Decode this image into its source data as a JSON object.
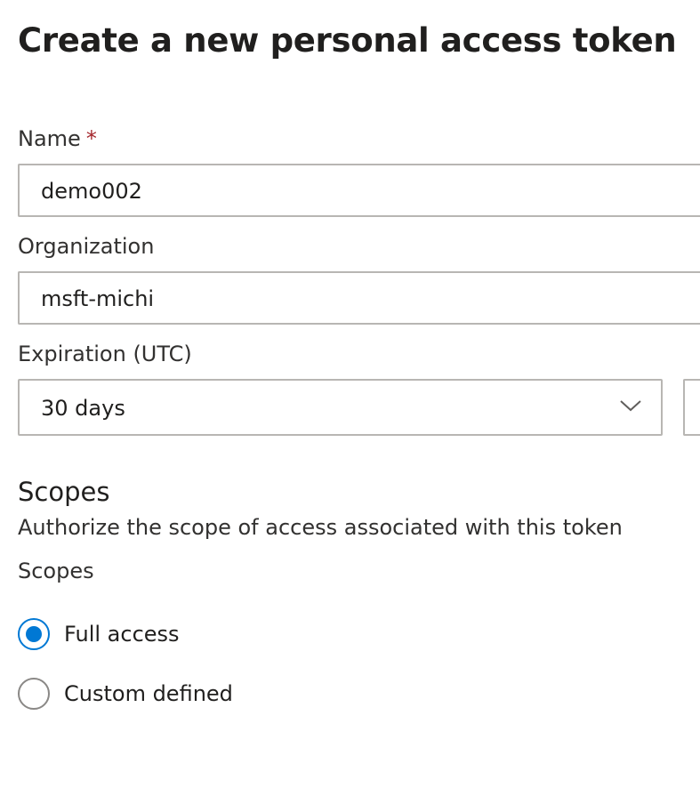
{
  "page": {
    "title": "Create a new personal access token"
  },
  "name_field": {
    "label": "Name",
    "required_marker": "*",
    "value": "demo002"
  },
  "organization_field": {
    "label": "Organization",
    "value": "msft-michi"
  },
  "expiration_field": {
    "label": "Expiration (UTC)",
    "selected": "30 days",
    "icon": "chevron-down-icon"
  },
  "scopes_section": {
    "title": "Scopes",
    "description": "Authorize the scope of access associated with this token",
    "group_label": "Scopes",
    "options": [
      {
        "label": "Full access",
        "checked": true
      },
      {
        "label": "Custom defined",
        "checked": false
      }
    ]
  },
  "colors": {
    "accent": "#0078d4",
    "required": "#a4262c",
    "border": "#b8b6b3"
  }
}
